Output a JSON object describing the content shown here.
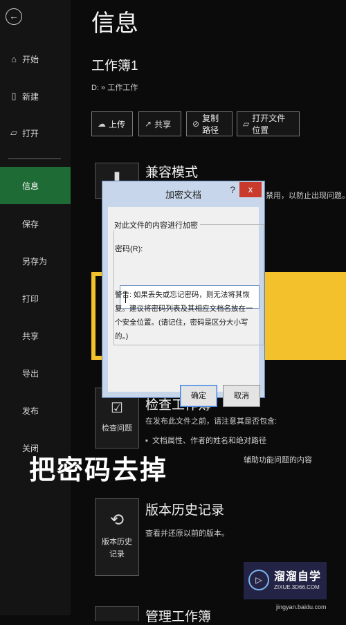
{
  "sidebar": {
    "items": [
      {
        "label": "开始"
      },
      {
        "label": "新建"
      },
      {
        "label": "打开"
      },
      {
        "label": "信息"
      },
      {
        "label": "保存"
      },
      {
        "label": "另存为"
      },
      {
        "label": "打印"
      },
      {
        "label": "共享"
      },
      {
        "label": "导出"
      },
      {
        "label": "发布"
      },
      {
        "label": "关闭"
      }
    ]
  },
  "header": {
    "title": "信息",
    "doc_name": "工作簿1",
    "path": "D: » 工作工作"
  },
  "actions": [
    {
      "label": "上传"
    },
    {
      "label": "共享"
    },
    {
      "label": "复制路径"
    },
    {
      "label": "打开文件位置"
    }
  ],
  "sections": {
    "compat": {
      "title": "兼容模式",
      "text_fragment": "禁用，以防止出现问题。转"
    },
    "inspect": {
      "title": "检查工作簿",
      "card_label": "检查问题",
      "text1": "在发布此文件之前，请注意其是否包含:",
      "text2": "文档属性、作者的姓名和绝对路径",
      "text3_fragment": "辅助功能问题的内容"
    },
    "versions": {
      "title": "版本历史记录",
      "card_label": "版本历史记录",
      "text": "查看并还原以前的版本。"
    },
    "manage": {
      "title": "管理工作簿"
    }
  },
  "overlay_caption": "把密码去掉",
  "dialog": {
    "title": "加密文档",
    "help": "?",
    "close": "x",
    "group_label": "对此文件的内容进行加密",
    "password_label": "密码(R):",
    "password_value": "",
    "warning": "警告: 如果丢失或忘记密码，则无法将其恢复。建议将密码列表及其相应文档名放在一个安全位置。(请记住，密码是区分大小写的。)",
    "ok": "确定",
    "cancel": "取消"
  },
  "watermark": {
    "brand": "溜溜自学",
    "url": "ZIXUE.3D66.COM"
  },
  "source_url": "jingyan.baidu.com"
}
